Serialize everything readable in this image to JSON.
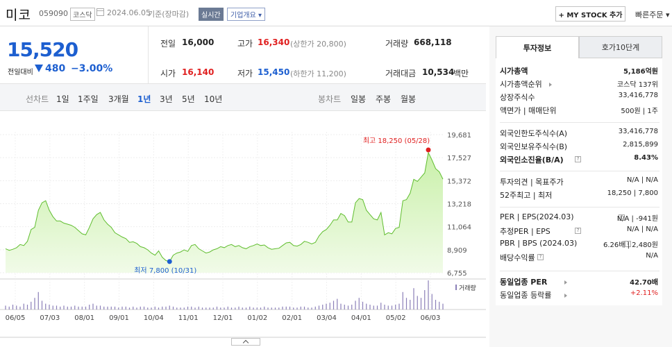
{
  "header": {
    "name": "미코",
    "code": "059090",
    "market": "코스닥",
    "date": "2024.06.05",
    "basis": "기준(장마감)",
    "realtime": "실시간",
    "overview": "기업개요",
    "mystock": "+ MY STOCK 추가",
    "quick_order": "빠른주문"
  },
  "summary": {
    "price": "15,520",
    "change_label": "전일대비",
    "change": "480",
    "change_pct": "−3.00%",
    "direction": "down",
    "prev_close_label": "전일",
    "prev_close": "16,000",
    "high_label": "고가",
    "high": "16,340",
    "upper_limit": "(상한가 20,800)",
    "volume_label": "거래량",
    "volume": "668,118",
    "open_label": "시가",
    "open": "16,140",
    "low_label": "저가",
    "low": "15,450",
    "lower_limit": "(하한가 11,200)",
    "amount_label": "거래대금",
    "amount": "10,534",
    "amount_unit": "백만"
  },
  "period_bar": {
    "line_label": "선차트",
    "line_periods": [
      "1일",
      "1주일",
      "3개월",
      "1년",
      "3년",
      "5년",
      "10년"
    ],
    "selected": "1년",
    "candle_label": "봉차트",
    "candle_periods": [
      "일봉",
      "주봉",
      "월봉"
    ]
  },
  "chart_data": {
    "type": "area",
    "x_tick_labels": [
      "06/05",
      "07/03",
      "08/01",
      "09/01",
      "10/04",
      "11/01",
      "12/01",
      "01/02",
      "02/01",
      "03/04",
      "04/01",
      "05/02",
      "06/03"
    ],
    "y_tick_labels": [
      "19,681",
      "17,527",
      "15,372",
      "13,218",
      "11,064",
      "8,909",
      "6,755"
    ],
    "ylim": [
      6755,
      19681
    ],
    "grid": true,
    "max_annotation": "최고 18,250 (05/28)",
    "min_annotation": "최저 7,800 (10/31)",
    "max_value": 18250,
    "min_value": 7800,
    "volume_label": "거래량",
    "price_series": [
      9000,
      8850,
      8950,
      9100,
      9400,
      9300,
      9700,
      10800,
      11000,
      12600,
      13300,
      13500,
      12600,
      12000,
      11600,
      11600,
      11400,
      11300,
      11200,
      11000,
      10700,
      10400,
      10300,
      11000,
      11800,
      12200,
      12400,
      11700,
      11300,
      11000,
      10500,
      10300,
      10100,
      9950,
      9600,
      9650,
      9500,
      9200,
      9100,
      8900,
      8600,
      8400,
      8800,
      8200,
      7900,
      7800,
      8400,
      8600,
      8700,
      8900,
      8750,
      9300,
      9400,
      9000,
      8800,
      8600,
      8700,
      8900,
      9000,
      9200,
      9100,
      9300,
      9400,
      9200,
      9300,
      9100,
      9000,
      9200,
      9300,
      9450,
      9300,
      9350,
      9100,
      8950,
      9000,
      9050,
      9300,
      9550,
      9600,
      9300,
      9250,
      9400,
      9700,
      9600,
      9450,
      9600,
      10200,
      10600,
      10800,
      11200,
      11700,
      11700,
      12300,
      12100,
      11500,
      11500,
      13300,
      13700,
      13600,
      12600,
      12200,
      11800,
      11700,
      12400,
      10300,
      10500,
      10400,
      10900,
      11000,
      13500,
      13600,
      14200,
      15500,
      15300,
      15700,
      16100,
      18000,
      17300,
      16500,
      16200,
      15520
    ],
    "volume_series": [
      4,
      3,
      5,
      4,
      3,
      6,
      5,
      8,
      12,
      18,
      9,
      6,
      5,
      4,
      4,
      3,
      4,
      3,
      3,
      4,
      3,
      3,
      3,
      5,
      6,
      4,
      4,
      3,
      3,
      3,
      3,
      2,
      3,
      3,
      2,
      3,
      2,
      3,
      3,
      2,
      2,
      3,
      2,
      3,
      3,
      4,
      3,
      2,
      2,
      2,
      3,
      3,
      2,
      3,
      2,
      2,
      2,
      2,
      3,
      2,
      2,
      3,
      2,
      2,
      3,
      2,
      2,
      3,
      2,
      2,
      2,
      3,
      2,
      2,
      2,
      2,
      3,
      3,
      3,
      2,
      2,
      3,
      3,
      2,
      2,
      3,
      4,
      5,
      6,
      7,
      9,
      11,
      6,
      5,
      4,
      5,
      9,
      12,
      8,
      6,
      5,
      4,
      4,
      7,
      5,
      4,
      4,
      5,
      6,
      18,
      12,
      10,
      22,
      14,
      12,
      20,
      30,
      16,
      10,
      8,
      6
    ]
  },
  "panel": {
    "tab_active": "투자정보",
    "tab_other": "호가10단계",
    "sec1": [
      {
        "k": "시가총액",
        "v": "5,186억원",
        "bold": true
      },
      {
        "k": "시가총액순위",
        "v": "코스닥 137위"
      },
      {
        "k": "상장주식수",
        "v": "33,416,778"
      },
      {
        "k": "액면가 | 매매단위",
        "v": "500원 | 1주"
      }
    ],
    "sec2": [
      {
        "k": "외국인한도주식수(A)",
        "v": "33,416,778"
      },
      {
        "k": "외국인보유주식수(B)",
        "v": "2,815,899"
      },
      {
        "k": "외국인소진율(B/A)",
        "v": "8.43%",
        "bold": true
      }
    ],
    "sec3": [
      {
        "k": "투자의견 | 목표주가",
        "v": "N/A | N/A"
      },
      {
        "k": "52주최고 | 최저",
        "v": "18,250 | 7,800"
      }
    ],
    "sec4": [
      {
        "k": "PER | EPS(2024.03)",
        "v": "N/A | -941원"
      },
      {
        "k": "추정PER | EPS",
        "v": "N/A | N/A"
      },
      {
        "k": "PBR | BPS (2024.03)",
        "v": "6.26배 | 2,480원"
      },
      {
        "k": "배당수익률",
        "v": "N/A"
      }
    ],
    "sec5": [
      {
        "k": "동일업종 PER",
        "v": "42.70배",
        "bold": true
      },
      {
        "k": "동일업종 등락률",
        "v": "+2.11%",
        "red": true
      }
    ]
  },
  "colors": {
    "down": "#1d5fd0",
    "up": "#e02020",
    "line": "#5fbd2e",
    "fill_top": "#c9f0a9",
    "fill_bottom": "#f1fbe8",
    "volume": "#8a7fb8"
  }
}
